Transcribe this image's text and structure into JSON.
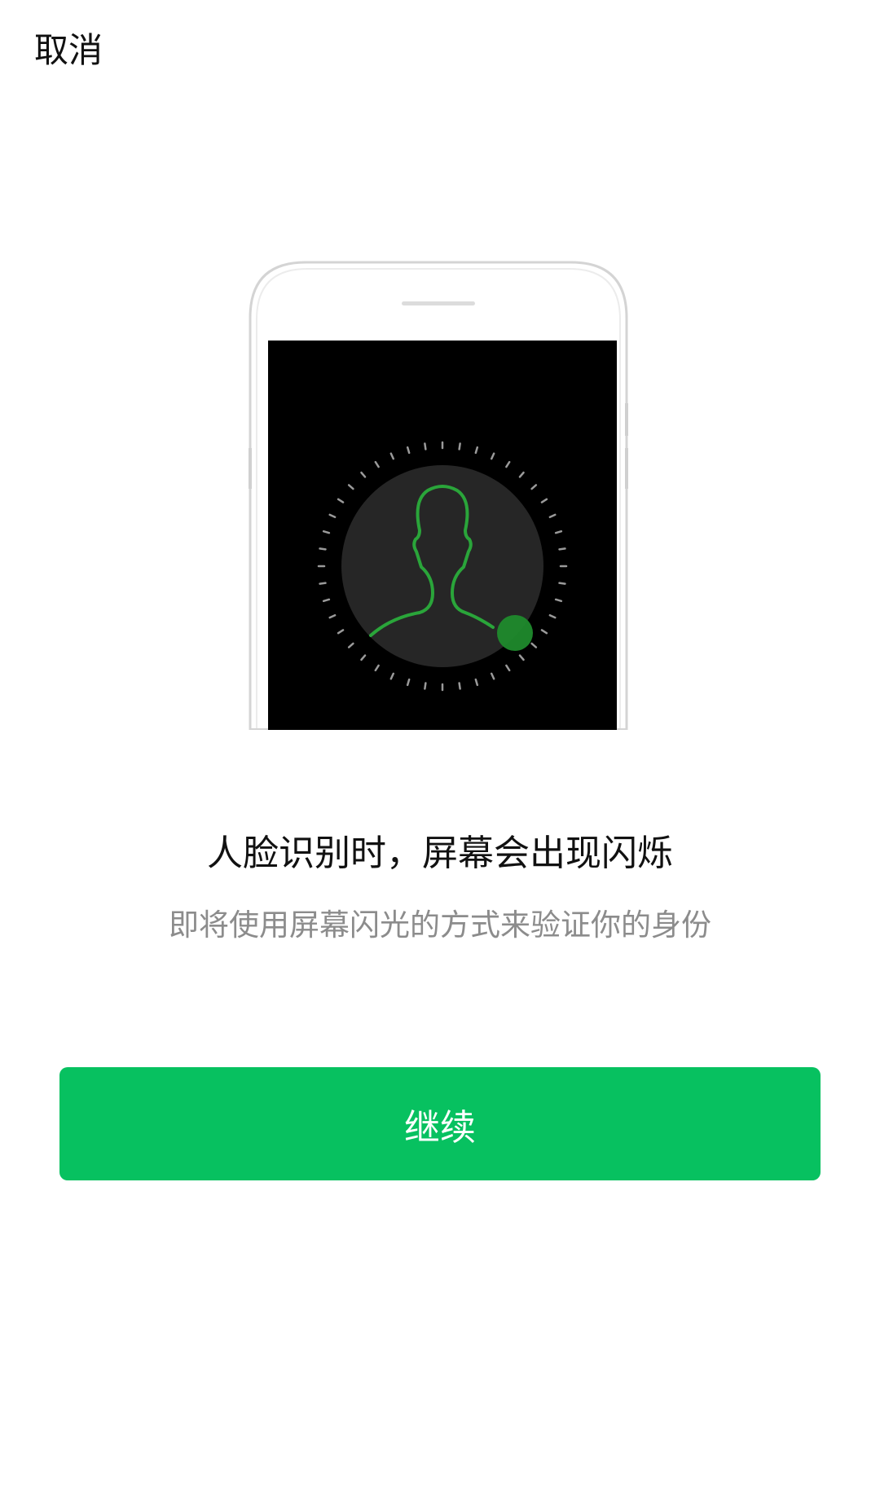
{
  "header": {
    "cancel_label": "取消"
  },
  "illustration": {
    "icon": "face-scan-phone-illustration"
  },
  "main": {
    "title": "人脸识别时，屏幕会出现闪烁",
    "subtitle": "即将使用屏幕闪光的方式来验证你的身份"
  },
  "actions": {
    "continue_label": "继续"
  },
  "colors": {
    "accent": "#07c160",
    "subtitle": "#8c8c8c",
    "screen": "#000000",
    "face_outline": "#2aa53a"
  }
}
